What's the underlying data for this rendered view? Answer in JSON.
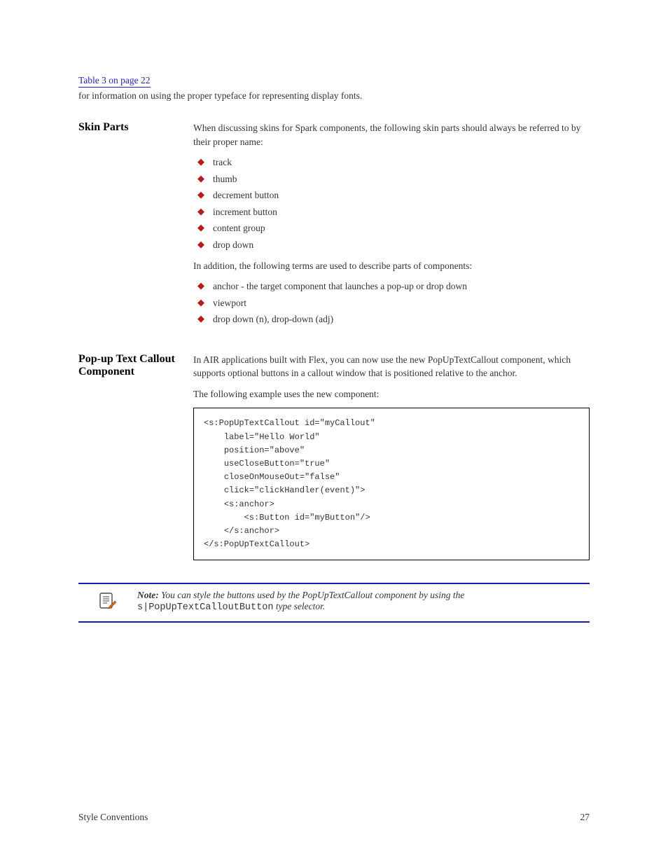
{
  "header": {
    "link_text": "Table 3 on page 22",
    "link_suffix": " for information on using the proper typeface for representing display fonts."
  },
  "section1": {
    "heading": "Skin Parts",
    "intro": "When discussing skins for Spark components, the following skin parts should always be referred to by their proper name:",
    "bullets_a": [
      "track",
      "thumb",
      "decrement button",
      "increment button",
      "content group",
      "drop down"
    ],
    "continuing": "In addition, the following terms are used to describe parts of components:",
    "bullets_b": [
      "anchor - the target component that launches a pop-up or drop down",
      "viewport",
      "drop down (n), drop-down (adj)"
    ]
  },
  "section2": {
    "heading": "Pop-up Text Callout Component",
    "para": "In AIR applications built with Flex, you can now use the new PopUpTextCallout component, which supports optional buttons in a callout window that is positioned relative to the anchor.",
    "example_lead": "The following example uses the new component:",
    "code": "<s:PopUpTextCallout id=\"myCallout\"\n    label=\"Hello World\"\n    position=\"above\"\n    useCloseButton=\"true\"\n    closeOnMouseOut=\"false\"\n    click=\"clickHandler(event)\">\n    <s:anchor>\n        <s:Button id=\"myButton\"/>\n    </s:anchor>\n</s:PopUpTextCallout>"
  },
  "note": {
    "label": "Note:",
    "text_pre": " You can style the buttons used by the PopUpTextCallout component by using the ",
    "code": "s|PopUpTextCalloutButton",
    "text_post": " type selector."
  },
  "footer": {
    "left": "Style Conventions",
    "right": "27"
  }
}
